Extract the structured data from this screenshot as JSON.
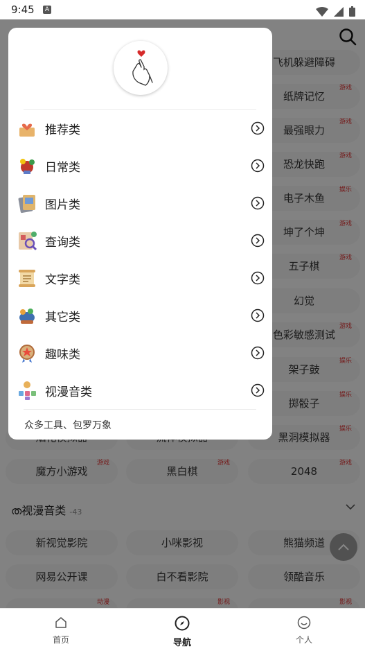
{
  "status": {
    "time": "9:45",
    "notif_letter": "A"
  },
  "background_list": {
    "right_column": [
      {
        "label": "飞机躲避障碍",
        "tag": ""
      },
      {
        "label": "纸牌记忆",
        "tag": "游戏"
      },
      {
        "label": "最强眼力",
        "tag": "游戏"
      },
      {
        "label": "恐龙快跑",
        "tag": "游戏"
      },
      {
        "label": "电子木鱼",
        "tag": "娱乐"
      },
      {
        "label": "坤了个坤",
        "tag": "游戏"
      },
      {
        "label": "五子棋",
        "tag": "游戏"
      },
      {
        "label": "幻觉",
        "tag": ""
      },
      {
        "label": "色彩敏感测试",
        "tag": "游戏"
      },
      {
        "label": "架子鼓",
        "tag": "娱乐"
      },
      {
        "label": "掷骰子",
        "tag": "娱乐"
      }
    ],
    "partial_row": [
      "烟花模拟器",
      "流体模拟器",
      "黑洞模拟器"
    ],
    "partial_row_tags": [
      "",
      "",
      "娱乐"
    ],
    "games_row": [
      {
        "label": "魔方小游戏",
        "tag": "游戏"
      },
      {
        "label": "黑白棋",
        "tag": "游戏"
      },
      {
        "label": "2048",
        "tag": "游戏"
      }
    ],
    "section": {
      "title": "视漫音类",
      "count": "-43"
    },
    "media_rows": [
      [
        "新视觉影院",
        "小咪影视",
        "熊猫频道"
      ],
      [
        "网易公开课",
        "白不看影院",
        "领酷音乐"
      ]
    ],
    "bottom_partial_tags": [
      "动漫",
      "影视",
      "影视"
    ]
  },
  "menu": {
    "items": [
      {
        "label": "推荐类",
        "icon": "recommend-icon"
      },
      {
        "label": "日常类",
        "icon": "daily-icon"
      },
      {
        "label": "图片类",
        "icon": "picture-icon"
      },
      {
        "label": "查询类",
        "icon": "query-icon"
      },
      {
        "label": "文字类",
        "icon": "text-icon"
      },
      {
        "label": "其它类",
        "icon": "other-icon"
      },
      {
        "label": "趣味类",
        "icon": "fun-icon"
      },
      {
        "label": "视漫音类",
        "icon": "media-icon"
      }
    ],
    "footer": "众多工具、包罗万象"
  },
  "tabs": [
    {
      "label": "首页",
      "icon": "home-icon"
    },
    {
      "label": "导航",
      "icon": "compass-icon",
      "active": true
    },
    {
      "label": "个人",
      "icon": "smile-icon"
    }
  ],
  "colors": {
    "accent": "#d33333",
    "overlay": "rgba(0,0,0,0.47)"
  }
}
